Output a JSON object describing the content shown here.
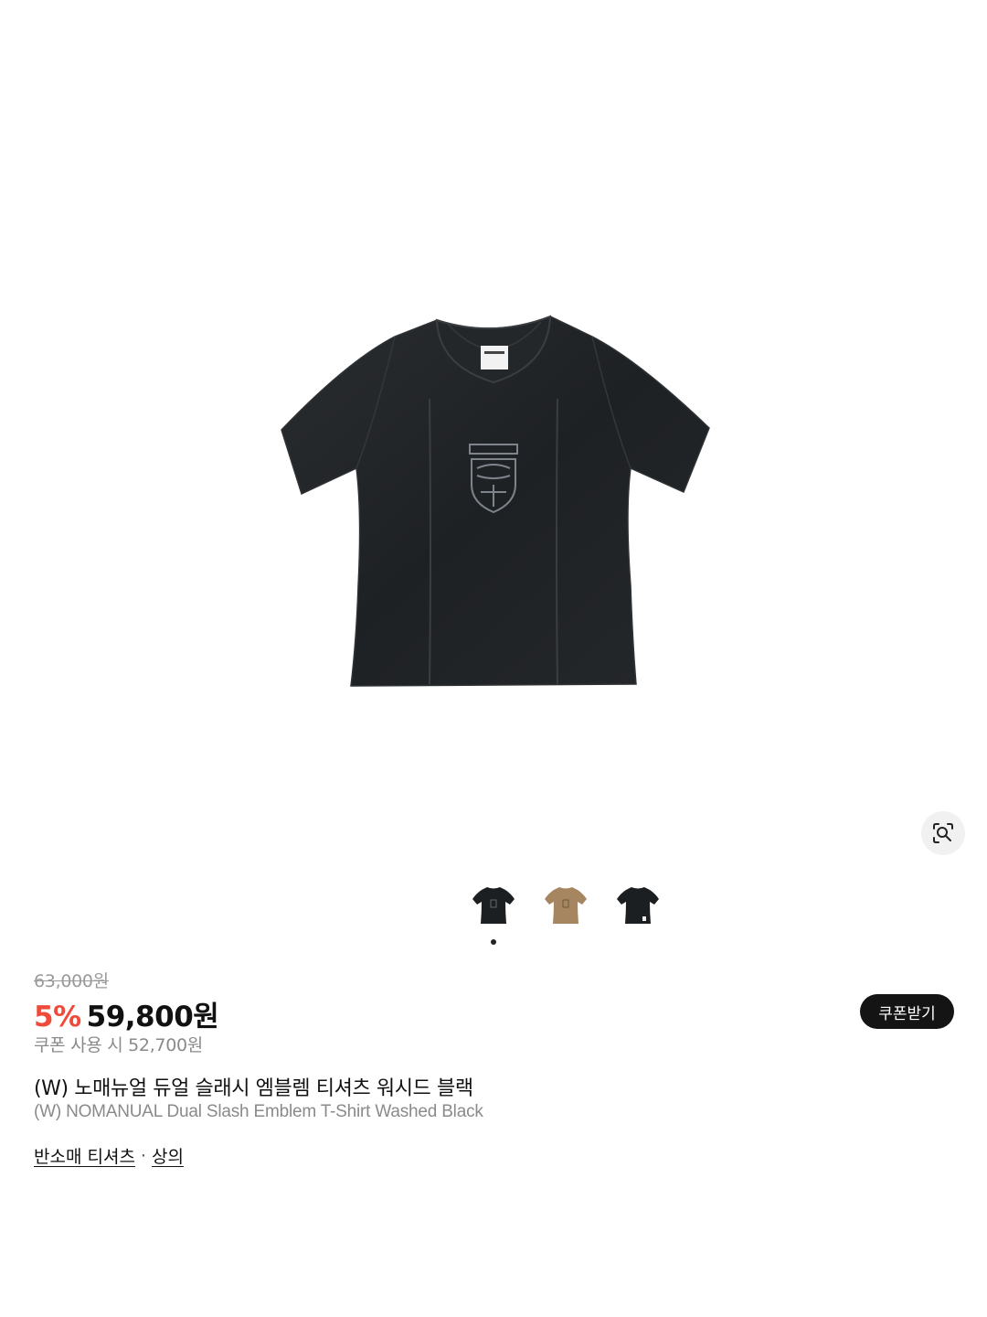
{
  "product": {
    "original_price": "63,000원",
    "discount_rate": "5%",
    "sale_price": "59,800원",
    "coupon_price": "쿠폰 사용 시 52,700원",
    "coupon_button_label": "쿠폰받기",
    "title_ko": "(W) 노매뉴얼 듀얼 슬래시 엠블렘 티셔츠 워시드 블랙",
    "title_en": "(W) NOMANUAL Dual Slash Emblem T-Shirt Washed Black"
  },
  "gallery": {
    "thumbnails": [
      {
        "color": "#1c1f21",
        "label": "black"
      },
      {
        "color": "#a58660",
        "label": "brown"
      },
      {
        "color": "#1c1f21",
        "label": "black"
      }
    ],
    "active_index": 0
  },
  "breadcrumb": {
    "items": [
      "반소매 티셔츠",
      "상의"
    ],
    "separator": "·"
  },
  "icons": {
    "lens": "image-search-icon"
  }
}
